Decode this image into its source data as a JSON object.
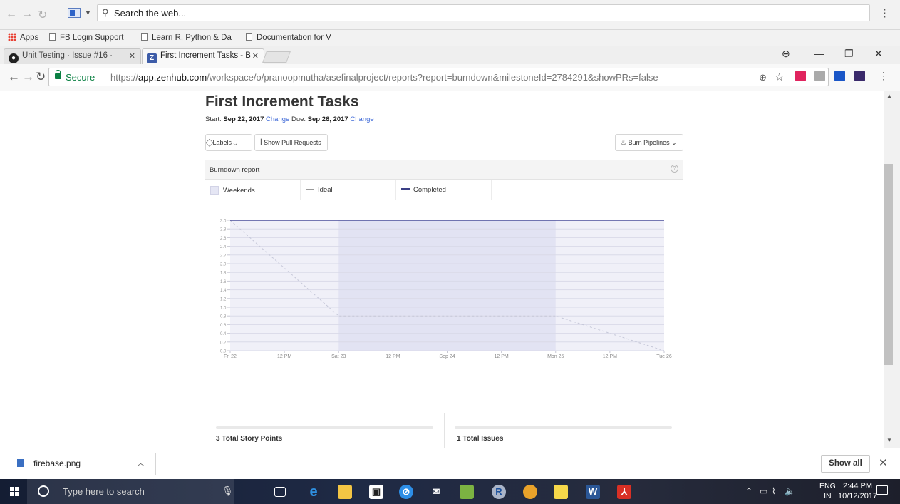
{
  "outer_browser": {
    "search_text": "Search the web...",
    "bookmarks": [
      {
        "label": "Apps"
      },
      {
        "label": "FB Login Support"
      },
      {
        "label": "Learn R, Python & Da"
      },
      {
        "label": "Documentation for V"
      }
    ]
  },
  "tabs": [
    {
      "title": "Unit Testing · Issue #16 ·",
      "active": false,
      "favicon": "github-icon"
    },
    {
      "title": "First Increment Tasks - B",
      "active": true,
      "favicon": "zenhub-icon"
    }
  ],
  "toolbar": {
    "secure_label": "Secure",
    "url_scheme": "https://",
    "url_host": "app.zenhub.com",
    "url_path": "/workspace/o/pranoopmutha/asefinalproject/reports?report=burndown&milestoneId=2784291&showPRs=false"
  },
  "page": {
    "title": "First Increment Tasks",
    "start_label": "Start:",
    "start_date": "Sep 22, 2017",
    "change_label": "Change",
    "due_label": "Due:",
    "due_date": "Sep 26, 2017",
    "labels_button": "Labels",
    "show_prs_button": "Show Pull Requests",
    "burn_pipelines_button": "Burn Pipelines",
    "panel_title": "Burndown report",
    "legend": {
      "weekends": "Weekends",
      "ideal": "Ideal",
      "completed": "Completed"
    },
    "stats": {
      "story_points": "3 Total Story Points",
      "issues": "1 Total Issues"
    }
  },
  "chart_data": {
    "type": "line",
    "x_ticks": [
      "Fri 22",
      "12 PM",
      "Sat 23",
      "12 PM",
      "Sep 24",
      "12 PM",
      "Mon 25",
      "12 PM",
      "Tue 26"
    ],
    "y_ticks": [
      "0.0",
      "0.2",
      "0.4",
      "0.6",
      "0.8",
      "1.0",
      "1.2",
      "1.4",
      "1.6",
      "1.8",
      "2.0",
      "2.2",
      "2.4",
      "2.6",
      "2.8",
      "3.0"
    ],
    "ylim": [
      0,
      3.0
    ],
    "x_range_hours": [
      0,
      96
    ],
    "weekend_band": {
      "from": "Sat 23",
      "to": "Mon 25"
    },
    "series": [
      {
        "name": "Ideal",
        "style": "dashed",
        "points": [
          [
            0,
            3.0
          ],
          [
            24,
            0.8
          ],
          [
            72,
            0.8
          ],
          [
            96,
            0.0
          ]
        ]
      },
      {
        "name": "Completed",
        "style": "solid",
        "points": [
          [
            0,
            3.0
          ],
          [
            96,
            3.0
          ]
        ]
      }
    ],
    "colors": {
      "ideal": "#c5c7d8",
      "completed": "#4b4f9a",
      "weekend": "#e2e3f3",
      "grid": "#d9dae8"
    }
  },
  "downloads": {
    "file": "firebase.png",
    "show_all": "Show all"
  },
  "taskbar": {
    "search_placeholder": "Type here to search",
    "lang_top": "ENG",
    "lang_bottom": "IN",
    "time": "2:44 PM",
    "date": "10/12/2017"
  }
}
